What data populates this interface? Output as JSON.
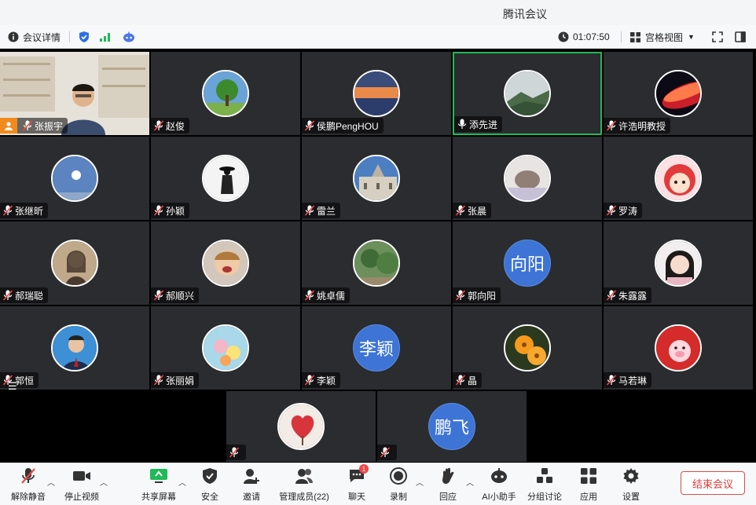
{
  "window": {
    "title": "腾讯会议"
  },
  "topbar": {
    "info_label": "会议详情",
    "timer": "01:07:50",
    "view_label": "宫格视图"
  },
  "participants": [
    {
      "name": "张振宇",
      "mic": "muted",
      "host": true,
      "avatar": "video-feed"
    },
    {
      "name": "赵俊",
      "mic": "muted",
      "avatar": "tree-photo"
    },
    {
      "name": "侯鹏PengHOU",
      "mic": "muted",
      "avatar": "sunset-photo"
    },
    {
      "name": "添先进",
      "mic": "on",
      "speaking": true,
      "avatar": "mountain-photo"
    },
    {
      "name": "许浩明教授",
      "mic": "muted",
      "avatar": "red-planet-photo"
    },
    {
      "name": "张继昕",
      "mic": "muted",
      "avatar": "sky-photo"
    },
    {
      "name": "孙颖",
      "mic": "muted",
      "avatar": "silhouette-photo"
    },
    {
      "name": "雷兰",
      "mic": "muted",
      "avatar": "building-photo"
    },
    {
      "name": "张晨",
      "mic": "muted",
      "avatar": "cat-photo"
    },
    {
      "name": "罗涛",
      "mic": "muted",
      "avatar": "cartoon-girl"
    },
    {
      "name": "郝瑞聪",
      "mic": "muted",
      "avatar": "portrait-photo"
    },
    {
      "name": "郝顺兴",
      "mic": "muted",
      "avatar": "child-photo"
    },
    {
      "name": "姚卓儒",
      "mic": "muted",
      "avatar": "forest-photo"
    },
    {
      "name": "郭向阳",
      "mic": "muted",
      "avatar_text": "向阳"
    },
    {
      "name": "朱露露",
      "mic": "muted",
      "avatar": "girl-photo"
    },
    {
      "name": "郭恒",
      "mic": "muted",
      "avatar": "man-portrait"
    },
    {
      "name": "张丽娟",
      "mic": "muted",
      "avatar": "flower-photo"
    },
    {
      "name": "李颖",
      "mic": "muted",
      "avatar_text": "李颖"
    },
    {
      "name": "晶",
      "mic": "muted",
      "avatar": "orange-flower-photo"
    },
    {
      "name": "马若琳",
      "mic": "muted",
      "avatar": "cartoon-pig"
    },
    {
      "name": "",
      "mic": "muted",
      "avatar": "heart-tree"
    },
    {
      "name": "",
      "mic": "muted",
      "avatar_text": "鹏飞"
    }
  ],
  "controls": [
    {
      "label": "解除静音",
      "icon": "mic-off-icon"
    },
    {
      "label": "停止视频",
      "icon": "camera-icon"
    },
    {
      "label": "共享屏幕",
      "icon": "share-screen-icon"
    },
    {
      "label": "安全",
      "icon": "shield-icon"
    },
    {
      "label": "邀请",
      "icon": "add-user-icon"
    },
    {
      "label": "管理成员(22)",
      "icon": "members-icon"
    },
    {
      "label": "聊天",
      "icon": "chat-icon",
      "badge": "1"
    },
    {
      "label": "录制",
      "icon": "record-icon"
    },
    {
      "label": "回应",
      "icon": "reaction-icon"
    },
    {
      "label": "AI小助手",
      "icon": "ai-assistant-icon"
    },
    {
      "label": "分组讨论",
      "icon": "breakout-icon"
    },
    {
      "label": "应用",
      "icon": "apps-icon"
    },
    {
      "label": "设置",
      "icon": "gear-icon"
    }
  ],
  "end_meeting_label": "结束会议",
  "colors": {
    "accent": "#1fba57",
    "avatar_blue": "#3d74d6",
    "end_red": "#d93a3a",
    "tile_bg": "#2b2c2f"
  }
}
